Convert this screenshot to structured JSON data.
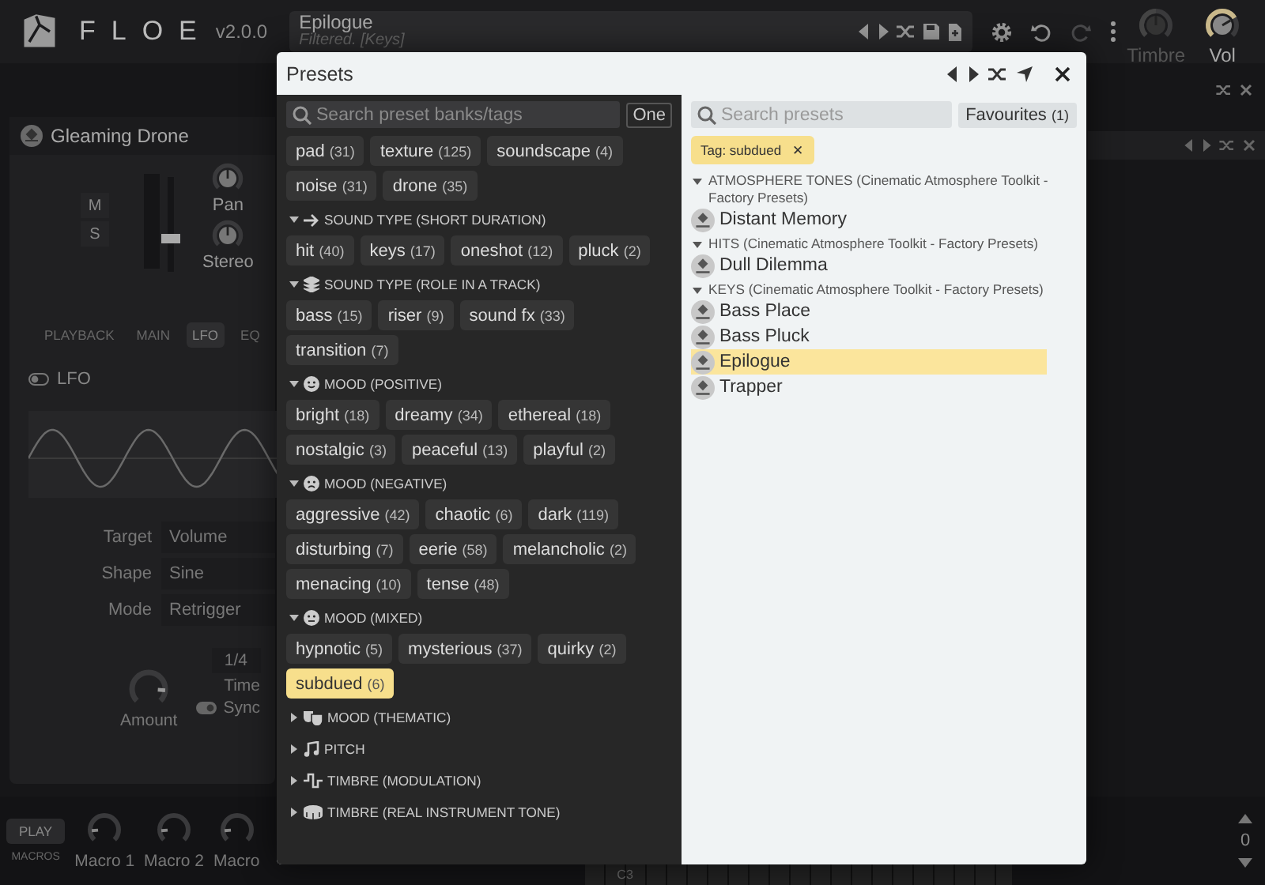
{
  "app": {
    "name": "FLOE",
    "version": "v2.0.0"
  },
  "preset_bar": {
    "name": "Epilogue",
    "status": "Filtered. [Keys]"
  },
  "top_knobs": [
    {
      "label": "Timbre",
      "disabled": true
    },
    {
      "label": "Vol",
      "disabled": false
    }
  ],
  "layer": {
    "name": "Gleaming Drone",
    "mute": "M",
    "solo": "S",
    "knobs": [
      {
        "label": "Pan"
      },
      {
        "label": "Stereo"
      }
    ],
    "tabs": [
      {
        "label": "PLAYBACK",
        "selected": false
      },
      {
        "label": "MAIN",
        "selected": false
      },
      {
        "label": "LFO",
        "selected": true
      },
      {
        "label": "EQ",
        "selected": false
      }
    ],
    "lfo": {
      "label": "LFO",
      "on": false,
      "fields": [
        {
          "label": "Target",
          "value": "Volume"
        },
        {
          "label": "Shape",
          "value": "Sine"
        },
        {
          "label": "Mode",
          "value": "Retrigger"
        }
      ],
      "amount": {
        "label": "Amount"
      },
      "time": {
        "value": "1/4",
        "label": "Time"
      },
      "sync": {
        "label": "Sync",
        "on": true
      }
    }
  },
  "macros": {
    "play": "PLAY",
    "label": "MACROS",
    "knobs": [
      {
        "label": "Macro 1"
      },
      {
        "label": "Macro 2"
      },
      {
        "label": "Macro"
      }
    ]
  },
  "keyboard": {
    "octave": "0",
    "note": "C3"
  },
  "presets": {
    "title": "Presets",
    "tag_search": {
      "placeholder": "Search preset banks/tags"
    },
    "one_button": "One",
    "tag_groups": [
      {
        "tags": [
          {
            "name": "pad",
            "count": "(31)",
            "selected": false
          },
          {
            "name": "texture",
            "count": "(125)",
            "selected": false
          },
          {
            "name": "soundscape",
            "count": "(4)",
            "selected": false
          },
          {
            "name": "noise",
            "count": "(31)",
            "selected": false
          },
          {
            "name": "drone",
            "count": "(35)",
            "selected": false
          }
        ]
      },
      {
        "title": "SOUND TYPE (SHORT DURATION)",
        "expanded": true,
        "tags": [
          {
            "name": "hit",
            "count": "(40)",
            "selected": false
          },
          {
            "name": "keys",
            "count": "(17)",
            "selected": false
          },
          {
            "name": "oneshot",
            "count": "(12)",
            "selected": false
          },
          {
            "name": "pluck",
            "count": "(2)",
            "selected": false
          }
        ]
      },
      {
        "title": "SOUND TYPE (ROLE IN A TRACK)",
        "expanded": true,
        "tags": [
          {
            "name": "bass",
            "count": "(15)",
            "selected": false
          },
          {
            "name": "riser",
            "count": "(9)",
            "selected": false
          },
          {
            "name": "sound fx",
            "count": "(33)",
            "selected": false
          },
          {
            "name": "transition",
            "count": "(7)",
            "selected": false
          }
        ]
      },
      {
        "title": "MOOD (POSITIVE)",
        "expanded": true,
        "tags": [
          {
            "name": "bright",
            "count": "(18)",
            "selected": false
          },
          {
            "name": "dreamy",
            "count": "(34)",
            "selected": false
          },
          {
            "name": "ethereal",
            "count": "(18)",
            "selected": false
          },
          {
            "name": "nostalgic",
            "count": "(3)",
            "selected": false
          },
          {
            "name": "peaceful",
            "count": "(13)",
            "selected": false
          },
          {
            "name": "playful",
            "count": "(2)",
            "selected": false
          }
        ]
      },
      {
        "title": "MOOD (NEGATIVE)",
        "expanded": true,
        "tags": [
          {
            "name": "aggressive",
            "count": "(42)",
            "selected": false
          },
          {
            "name": "chaotic",
            "count": "(6)",
            "selected": false
          },
          {
            "name": "dark",
            "count": "(119)",
            "selected": false
          },
          {
            "name": "disturbing",
            "count": "(7)",
            "selected": false
          },
          {
            "name": "eerie",
            "count": "(58)",
            "selected": false
          },
          {
            "name": "melancholic",
            "count": "(2)",
            "selected": false
          },
          {
            "name": "menacing",
            "count": "(10)",
            "selected": false
          },
          {
            "name": "tense",
            "count": "(48)",
            "selected": false
          }
        ]
      },
      {
        "title": "MOOD (MIXED)",
        "expanded": true,
        "tags": [
          {
            "name": "hypnotic",
            "count": "(5)",
            "selected": false
          },
          {
            "name": "mysterious",
            "count": "(37)",
            "selected": false
          },
          {
            "name": "quirky",
            "count": "(2)",
            "selected": false
          },
          {
            "name": "subdued",
            "count": "(6)",
            "selected": true
          }
        ]
      },
      {
        "title": "MOOD (THEMATIC)",
        "expanded": false
      },
      {
        "title": "PITCH",
        "expanded": false
      },
      {
        "title": "TIMBRE (MODULATION)",
        "expanded": false
      },
      {
        "title": "TIMBRE (REAL INSTRUMENT TONE)",
        "expanded": false
      }
    ],
    "preset_search": {
      "placeholder": "Search presets"
    },
    "favourites": {
      "label": "Favourites",
      "count": "(1)"
    },
    "filter_chip": {
      "label": "Tag: subdued",
      "remove": "✕"
    },
    "banks": [
      {
        "title": "ATMOSPHERE TONES (Cinematic Atmosphere Toolkit - Factory Presets)",
        "expanded": true,
        "presets": [
          {
            "name": "Distant Memory",
            "selected": false
          }
        ]
      },
      {
        "title": "HITS (Cinematic Atmosphere Toolkit - Factory Presets)",
        "expanded": true,
        "presets": [
          {
            "name": "Dull Dilemma",
            "selected": false
          }
        ]
      },
      {
        "title": "KEYS (Cinematic Atmosphere Toolkit - Factory Presets)",
        "expanded": true,
        "presets": [
          {
            "name": "Bass Place",
            "selected": false
          },
          {
            "name": "Bass Pluck",
            "selected": false
          },
          {
            "name": "Epilogue",
            "selected": true
          },
          {
            "name": "Trapper",
            "selected": false
          }
        ]
      }
    ]
  }
}
